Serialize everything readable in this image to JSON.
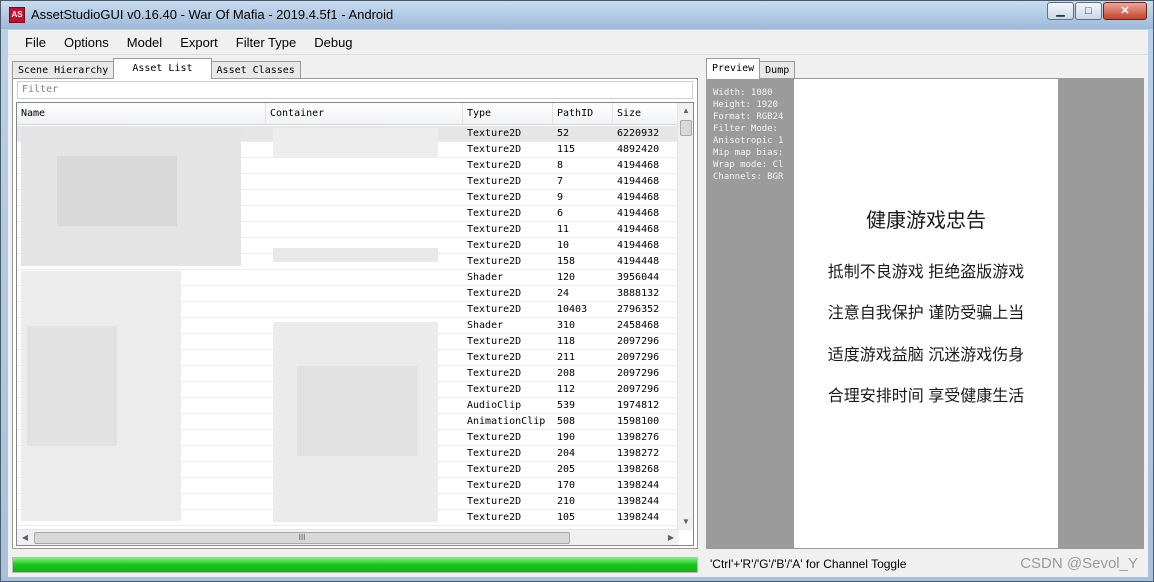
{
  "window": {
    "icon_text": "AS",
    "title": "AssetStudioGUI v0.16.40 - War Of Mafia - 2019.4.5f1 - Android",
    "minimize": "▁",
    "maximize": "□",
    "close": "✕"
  },
  "menu": [
    "File",
    "Options",
    "Model",
    "Export",
    "Filter Type",
    "Debug"
  ],
  "left_tabs": [
    "Scene Hierarchy",
    "Asset List",
    "Asset Classes"
  ],
  "filter_placeholder": "Filter",
  "columns": [
    "Name",
    "Container",
    "Type",
    "PathID",
    "Size"
  ],
  "rows": [
    {
      "type": "Texture2D",
      "pathid": "52",
      "size": "6220932"
    },
    {
      "type": "Texture2D",
      "pathid": "115",
      "size": "4892420"
    },
    {
      "type": "Texture2D",
      "pathid": "8",
      "size": "4194468"
    },
    {
      "type": "Texture2D",
      "pathid": "7",
      "size": "4194468"
    },
    {
      "type": "Texture2D",
      "pathid": "9",
      "size": "4194468"
    },
    {
      "type": "Texture2D",
      "pathid": "6",
      "size": "4194468"
    },
    {
      "type": "Texture2D",
      "pathid": "11",
      "size": "4194468"
    },
    {
      "type": "Texture2D",
      "pathid": "10",
      "size": "4194468"
    },
    {
      "type": "Texture2D",
      "pathid": "158",
      "size": "4194448"
    },
    {
      "type": "Shader",
      "pathid": "120",
      "size": "3956044"
    },
    {
      "type": "Texture2D",
      "pathid": "24",
      "size": "3888132"
    },
    {
      "type": "Texture2D",
      "pathid": "10403",
      "size": "2796352"
    },
    {
      "type": "Shader",
      "pathid": "310",
      "size": "2458468"
    },
    {
      "type": "Texture2D",
      "pathid": "118",
      "size": "2097296"
    },
    {
      "type": "Texture2D",
      "pathid": "211",
      "size": "2097296"
    },
    {
      "type": "Texture2D",
      "pathid": "208",
      "size": "2097296"
    },
    {
      "type": "Texture2D",
      "pathid": "112",
      "size": "2097296"
    },
    {
      "type": "AudioClip",
      "pathid": "539",
      "size": "1974812"
    },
    {
      "type": "AnimationClip",
      "pathid": "508",
      "size": "1598100"
    },
    {
      "type": "Texture2D",
      "pathid": "190",
      "size": "1398276"
    },
    {
      "type": "Texture2D",
      "pathid": "204",
      "size": "1398272"
    },
    {
      "type": "Texture2D",
      "pathid": "205",
      "size": "1398268"
    },
    {
      "type": "Texture2D",
      "pathid": "170",
      "size": "1398244"
    },
    {
      "type": "Texture2D",
      "pathid": "210",
      "size": "1398244"
    },
    {
      "type": "Texture2D",
      "pathid": "105",
      "size": "1398244"
    }
  ],
  "hscroll_grip": "III",
  "progress_fraction": 1.0,
  "right_tabs": [
    "Preview",
    "Dump"
  ],
  "texture_info": [
    "Width: 1080",
    "Height: 1920",
    "Format: RGB24",
    "Filter Mode: ",
    "Anisotropic 1",
    "Mip map bias:",
    "Wrap mode: Cl",
    "Channels: BGR"
  ],
  "preview": {
    "heading": "健康游戏忠告",
    "lines": [
      "抵制不良游戏    拒绝盗版游戏",
      "注意自我保护    谨防受骗上当",
      "适度游戏益脑    沉迷游戏伤身",
      "合理安排时间    享受健康生活"
    ]
  },
  "status_text": "'Ctrl'+'R'/'G'/'B'/'A' for Channel Toggle",
  "watermark": "CSDN @Sevol_Y",
  "colors": {
    "progress": "#1bc61b",
    "preview_bg": "#9b9b9b"
  }
}
